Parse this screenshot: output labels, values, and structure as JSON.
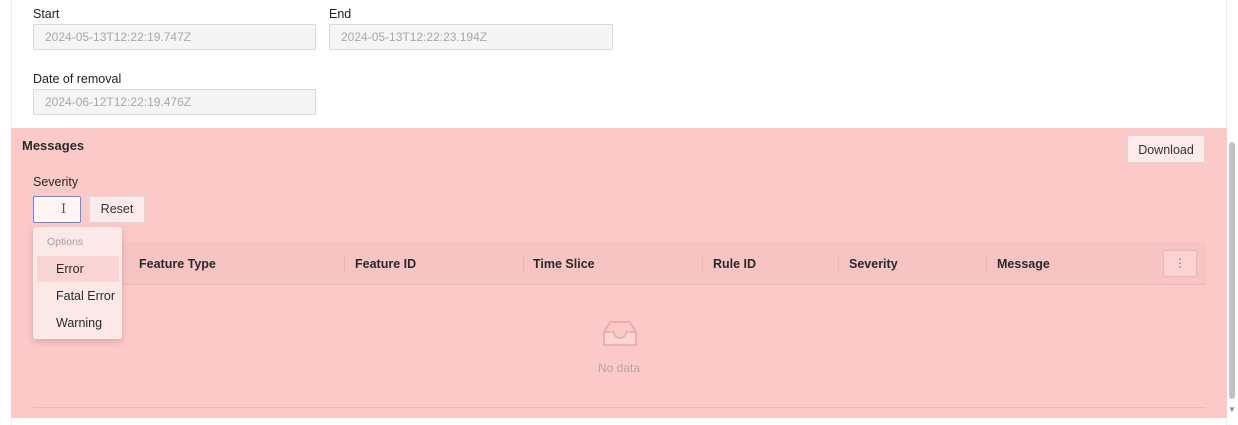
{
  "fields": {
    "start": {
      "label": "Start",
      "value": "2024-05-13T12:22:19.747Z"
    },
    "end": {
      "label": "End",
      "value": "2024-05-13T12:22:23.194Z"
    },
    "removal": {
      "label": "Date of removal",
      "value": "2024-06-12T12:22:19.476Z"
    }
  },
  "messages": {
    "title": "Messages",
    "download_label": "Download",
    "severity_label": "Severity",
    "severity_value": "",
    "reset_label": "Reset",
    "dropdown": {
      "group_label": "Options",
      "options": [
        "Error",
        "Fatal Error",
        "Warning"
      ],
      "highlighted": "Error"
    },
    "table": {
      "columns": [
        "Feature Type",
        "Feature ID",
        "Time Slice",
        "Rule ID",
        "Severity",
        "Message"
      ],
      "rows": [],
      "empty_text": "No data",
      "menu_icon": "more-vertical-icon"
    }
  },
  "colors": {
    "panel_bg": "#fcc9c9",
    "focus_border": "#5b8def"
  },
  "icons": {
    "empty": "inbox-icon",
    "cursor": "text-cursor-icon"
  }
}
